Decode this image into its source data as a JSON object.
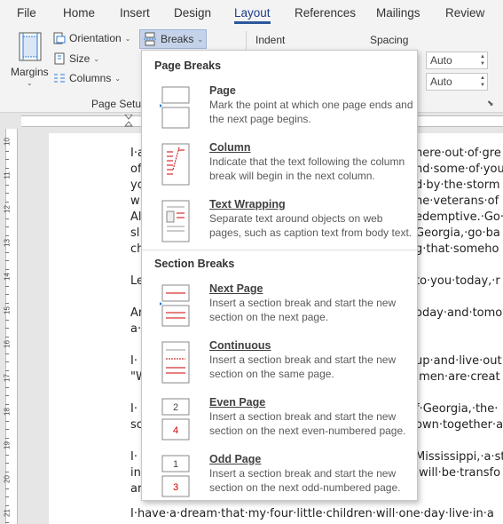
{
  "tabs": [
    "File",
    "Home",
    "Insert",
    "Design",
    "Layout",
    "References",
    "Mailings",
    "Review"
  ],
  "active_tab": "Layout",
  "ribbon": {
    "margins": "Margins",
    "orientation": "Orientation",
    "size": "Size",
    "columns": "Columns",
    "breaks": "Breaks",
    "page_setup": "Page Setup",
    "indent": "Indent",
    "spacing": "Spacing",
    "spacing_before": "Auto",
    "spacing_after": "Auto"
  },
  "dropdown": {
    "page_breaks_header": "Page Breaks",
    "section_breaks_header": "Section Breaks",
    "page_breaks": [
      {
        "title": "Page",
        "desc": "Mark the point at which one page ends and the next page begins."
      },
      {
        "title": "Column",
        "desc": "Indicate that the text following the column break will begin in the next column."
      },
      {
        "title": "Text Wrapping",
        "desc": "Separate text around objects on web pages, such as caption text from body text."
      }
    ],
    "section_breaks": [
      {
        "title": "Next Page",
        "desc": "Insert a section break and start the new section on the next page."
      },
      {
        "title": "Continuous",
        "desc": "Insert a section break and start the new section on the same page."
      },
      {
        "title": "Even Page",
        "desc": "Insert a section break and start the new section on the next even-numbered page."
      },
      {
        "title": "Odd Page",
        "desc": "Insert a section break and start the new section on the next odd-numbered page."
      }
    ]
  },
  "ruler_numbers": [
    "10",
    "11",
    "12",
    "13",
    "14",
    "15",
    "16",
    "17",
    "18",
    "19",
    "20",
    "21"
  ],
  "document_lines": [
    {
      "text": "I·a"
    },
    {
      "text": "of"
    },
    {
      "text": "yo"
    },
    {
      "text": "w"
    },
    {
      "text": "Al"
    },
    {
      "text": "sl"
    },
    {
      "text": "ch"
    },
    {
      "text": "Le"
    },
    {
      "text": "Ar"
    },
    {
      "text": "a·"
    },
    {
      "text": "I·"
    },
    {
      "text": "\"W"
    },
    {
      "text": "I·"
    },
    {
      "text": "sc"
    },
    {
      "text": "I·"
    },
    {
      "text": "in"
    },
    {
      "text": "ar"
    },
    {
      "text": "here·out·of·gre"
    },
    {
      "text": "nd·some·of·you"
    },
    {
      "text": "d·by·the·storm"
    },
    {
      "text": "he·veterans·of"
    },
    {
      "text": "edemptive.·Go·"
    },
    {
      "text": "Georgia,·go·ba"
    },
    {
      "text": "g·that·someho"
    },
    {
      "text": "to·you·today,·r"
    },
    {
      "text": "oday·and·tomo"
    },
    {
      "text": "up·and·live·out"
    },
    {
      "text": "·men·are·creat"
    },
    {
      "text": "f·Georgia,·the·"
    },
    {
      "text": "own·together·a"
    },
    {
      "text": "Mississippi,·a·st"
    },
    {
      "text": "·will·be·transfo"
    },
    {
      "text": "I·have·a·dream·that·my·four·little·children·will·one·day·live·in·a"
    }
  ]
}
